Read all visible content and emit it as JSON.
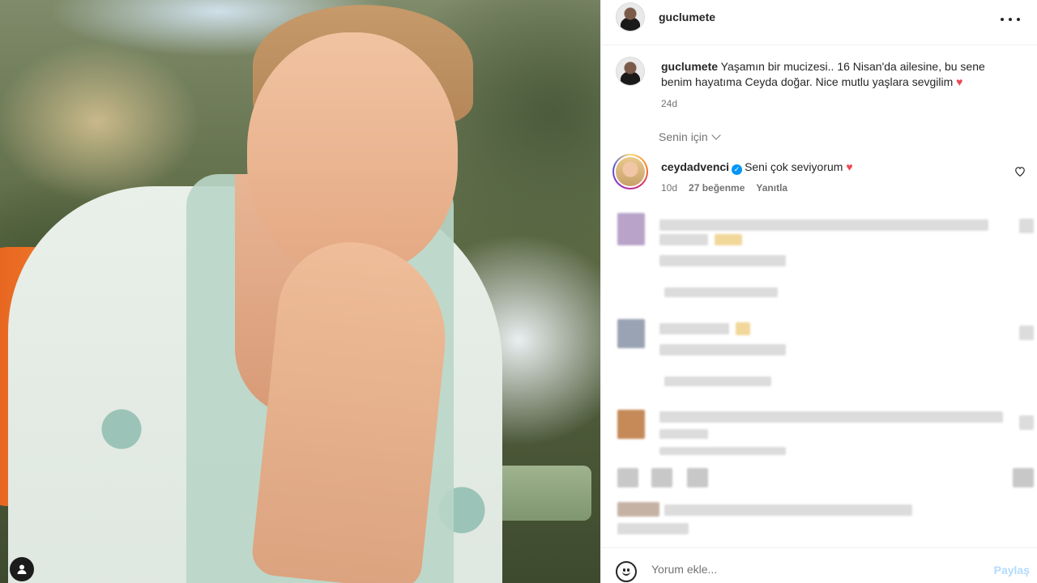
{
  "post": {
    "author": "guclumete",
    "caption_text": "Yaşamın bir mucizesi.. 16 Nisan'da ailesine, bu sene benim hayatıma Ceyda doğar. Nice mutlu yaşlara sevgilim",
    "caption_emoji": "♥",
    "age": "24d"
  },
  "comments_filter": "Senin için",
  "pinned_comment": {
    "username": "ceydadvenci",
    "text": "Seni çok seviyorum",
    "emoji": "♥",
    "age": "10d",
    "likes": "27 beğenme",
    "reply": "Yanıtla"
  },
  "composer": {
    "placeholder": "Yorum ekle...",
    "post_label": "Paylaş"
  },
  "icons": {
    "more": "more-horizontal-icon",
    "verified": "verified-badge-icon",
    "like": "heart-outline-icon",
    "emoji": "emoji-icon",
    "user": "user-tag-icon"
  },
  "colors": {
    "text": "#262626",
    "secondary": "#737373",
    "verified": "#0095f6",
    "heart": "#ed4956",
    "post_disabled": "#b3dbff"
  }
}
